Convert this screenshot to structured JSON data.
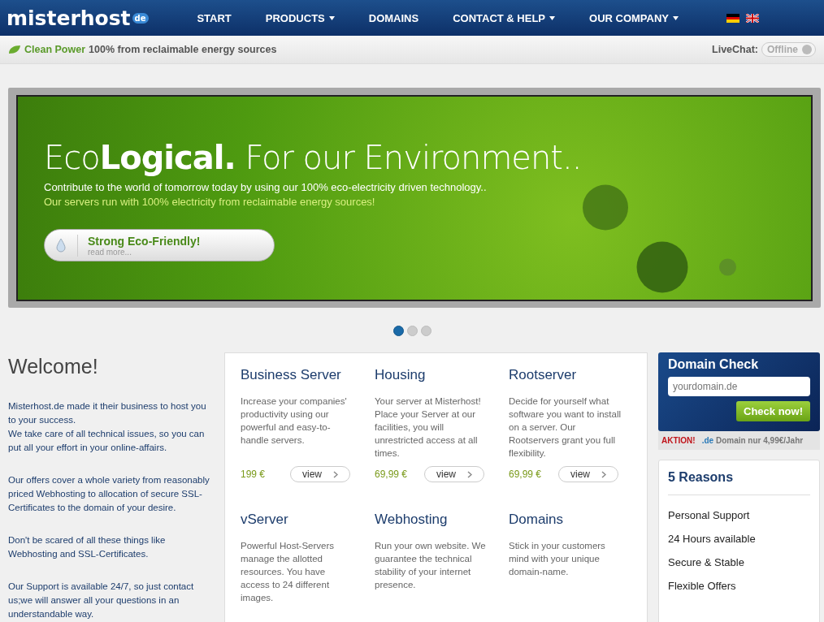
{
  "header": {
    "logo": "misterhost",
    "logo_badge": "de",
    "nav": [
      {
        "label": "START",
        "dropdown": false
      },
      {
        "label": "PRODUCTS",
        "dropdown": true
      },
      {
        "label": "DOMAINS",
        "dropdown": false
      },
      {
        "label": "CONTACT & HELP",
        "dropdown": true
      },
      {
        "label": "OUR COMPANY",
        "dropdown": true
      }
    ],
    "languages": [
      {
        "kind": "de",
        "selected": false
      },
      {
        "kind": "uk",
        "selected": false
      }
    ]
  },
  "info_bar": {
    "highlight": "Clean Power",
    "text": "100% from reclaimable energy sources",
    "livechat_label": "LiveChat:",
    "livechat_status": "Offline",
    "livechat_on": false
  },
  "banner": {
    "headline_light": "Eco",
    "headline_bold": "Logical.",
    "headline_rest": "For  our Environment..",
    "line_1": "Contribute to the world of tomorrow today by using our 100% eco-electricity driven technology..",
    "line_2": "Our servers run with 100% electricity from reclaimable energy sources!",
    "button_title": "Strong  Eco-Friendly!",
    "button_sub": "read more...",
    "dots": [
      {
        "selected": true
      },
      {
        "selected": false
      },
      {
        "selected": false
      }
    ]
  },
  "welcome": {
    "title": "Welcome!",
    "paragraphs": [
      "Misterhost.de made it their business to host you to your success.\nWe take care of all technical issues, so you can put all your effort in your online-affairs.",
      "Our offers cover a whole variety from reasonably priced Webhosting to allocation of secure SSL-Certificates to the domain of your desire.",
      "Don't be scared of all these things like Webhosting and SSL-Certificates.",
      "Our Support is available 24/7, so just contact us;we will answer all your questions in an understandable way."
    ]
  },
  "products": [
    {
      "title": "Business Server",
      "text": "Increase your companies' productivity using our powerful and easy-to-handle servers.",
      "price": "199 €",
      "button": "view"
    },
    {
      "title": "Housing",
      "text": "Your server at Misterhost! Place your Server at our facilities, you will unrestricted access at all times.",
      "price": "69,99 €",
      "button": "view"
    },
    {
      "title": "Rootserver",
      "text": "Decide for yourself what software you want to install on a server. Our Rootservers grant you full flexibility.",
      "price": "69,99 €",
      "button": "view"
    },
    {
      "title": "vServer",
      "text": "Powerful Host-Servers manage the allotted resources. You have access to 24 different images."
    },
    {
      "title": "Webhosting",
      "text": "Run your own website. We guarantee the technical stability of your internet presence."
    },
    {
      "title": "Domains",
      "text": "Stick in your customers mind with your unique domain-name."
    }
  ],
  "domain_check": {
    "title": "Domain Check",
    "placeholder": "yourdomain.de",
    "button": "Check now!",
    "promo_label": "AKTION!",
    "promo_tld": ".de",
    "promo_text": "Domain nur 4,99€/Jahr"
  },
  "reasons": {
    "title": "5 Reasons",
    "items": [
      "Personal Support",
      "24 Hours available",
      "Secure & Stable",
      "Flexible Offers"
    ]
  }
}
